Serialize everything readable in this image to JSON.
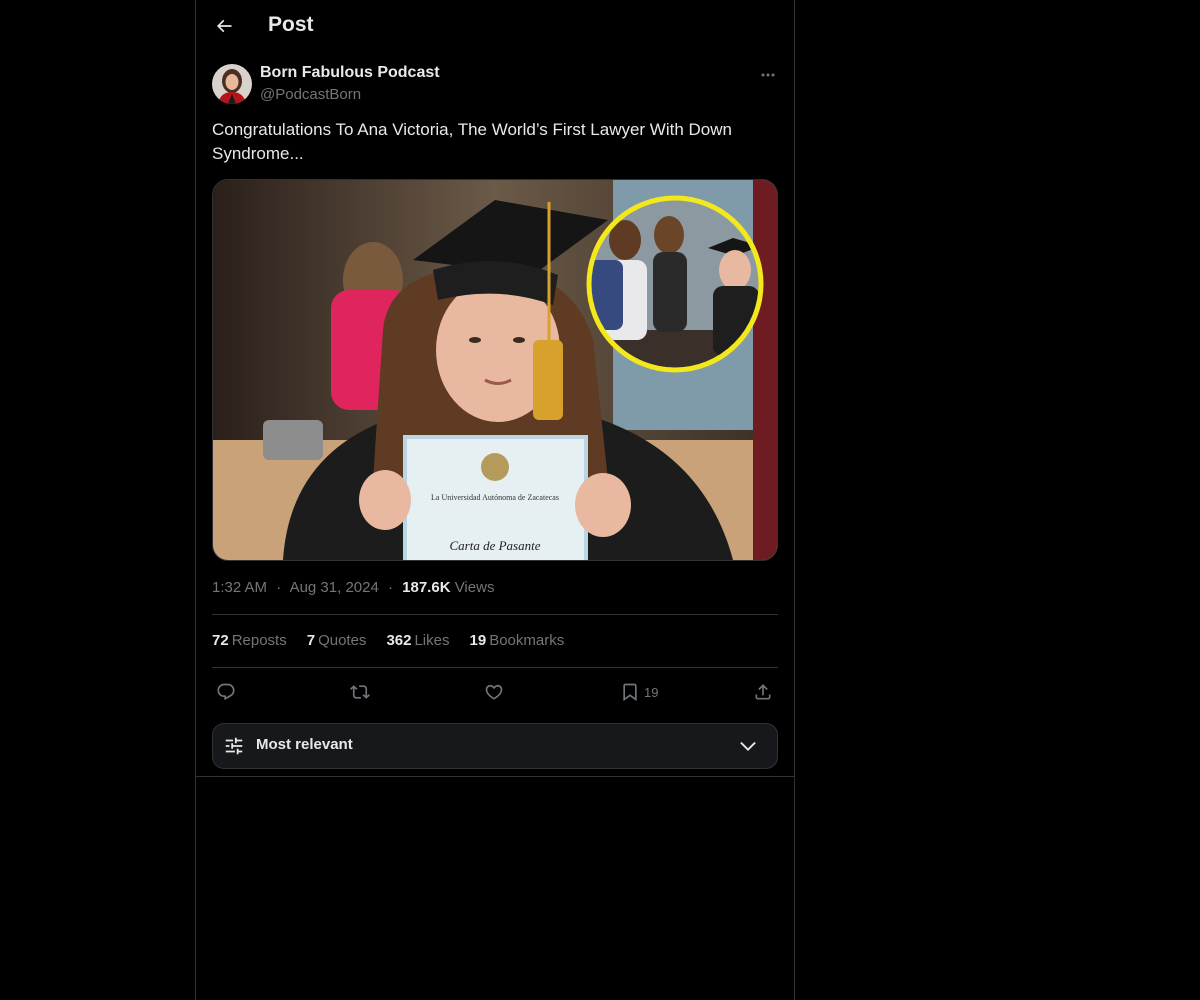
{
  "header": {
    "title": "Post"
  },
  "post": {
    "author": {
      "name": "Born Fabulous Podcast",
      "handle": "@PodcastBorn"
    },
    "text": "Congratulations To Ana Victoria, The World’s First Lawyer With Down Syndrome...",
    "image": {
      "certificate_line1": "La Universidad Autónoma de Zacatecas",
      "certificate_line2": "Carta de Pasante"
    },
    "time": "1:32 AM",
    "separator": "·",
    "date": "Aug 31, 2024",
    "views_count": "187.6K",
    "views_label": "Views"
  },
  "stats": {
    "reposts": {
      "count": "72",
      "label": "Reposts"
    },
    "quotes": {
      "count": "7",
      "label": "Quotes"
    },
    "likes": {
      "count": "362",
      "label": "Likes"
    },
    "bookmarks": {
      "count": "19",
      "label": "Bookmarks"
    }
  },
  "actions": {
    "reply_icon": "reply-icon",
    "repost_icon": "repost-icon",
    "like_icon": "heart-icon",
    "bookmark_icon": "bookmark-icon",
    "bookmark_count": "19",
    "share_icon": "share-icon"
  },
  "sort": {
    "label": "Most relevant"
  },
  "colors": {
    "background": "#000000",
    "text": "#e7e9ea",
    "secondary": "#71767b",
    "border": "#2f3336",
    "highlight_ring": "#f2e81c"
  }
}
